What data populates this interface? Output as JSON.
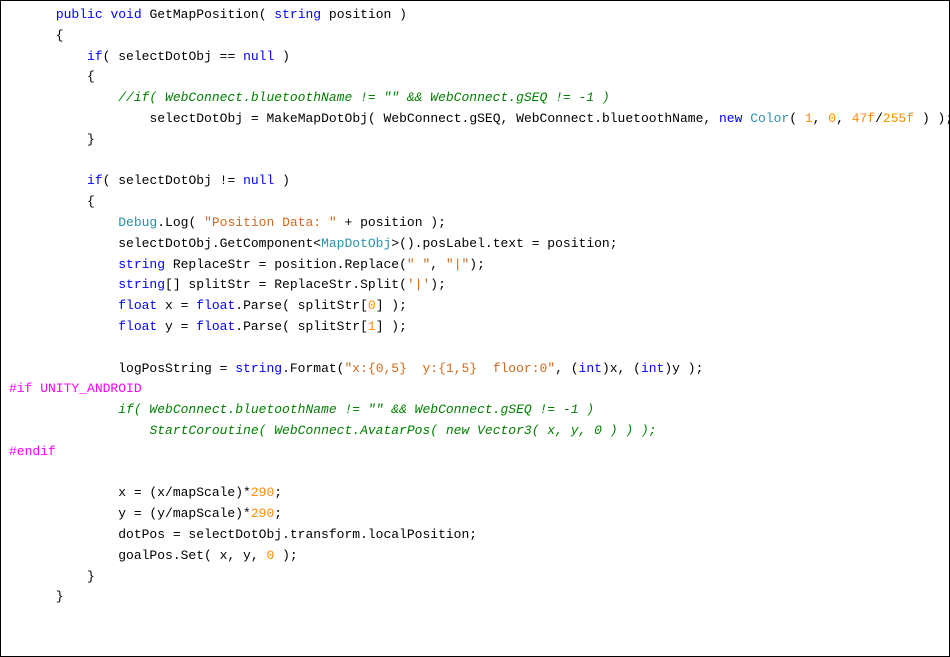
{
  "code": {
    "line1_indent": "      ",
    "kw_public": "public",
    "kw_void": "void",
    "method_name": "GetMapPosition",
    "param_type": "string",
    "param_name": "position",
    "line2_brace_open": "      {",
    "line3_indent": "          ",
    "kw_if": "if",
    "cond1_left": "selectDotObj",
    "op_eq": "==",
    "kw_null": "null",
    "line4_brace": "          {",
    "line5_indent": "              ",
    "comment1": "//if( WebConnect.bluetoothName != \"\" && WebConnect.gSEQ != -1 )",
    "line6_indent": "                  ",
    "assign1_lhs": "selectDotObj",
    "assign1_eq": "=",
    "make_call": "MakeMapDotObj( WebConnect.gSEQ, WebConnect.bluetoothName,",
    "kw_new": "new",
    "color_type": "Color",
    "color_open": "(",
    "num_1": "1",
    "num_0": "0",
    "num_47f": "47f",
    "num_255f": "255f",
    "color_close_tail": " ) );",
    "line7_brace": "          }",
    "line_blank": "",
    "cond2": "selectDotObj !=",
    "line9_brace": "          {",
    "debug_type": "Debug",
    "debug_log": ".Log(",
    "string_posdata": "\"Position Data: \"",
    "plus_position": " + position );",
    "line11": "              selectDotObj.GetComponent<",
    "mapdot_type": "MapDotObj",
    "line11_tail": ">().posLabel.text = position;",
    "line12_kw_string": "string",
    "line12_var": " ReplaceStr = position.Replace(",
    "string_space": "\" \"",
    "comma_sep": ", ",
    "string_pipe": "\"|\"",
    "line12_tail": ");",
    "line13_b": "[] splitStr = ReplaceStr.Split(",
    "char_pipe": "'|'",
    "line13_tail": ");",
    "kw_float": "float",
    "line14_mid": " x = ",
    "float_type": "float",
    "parse_call": ".Parse( splitStr[",
    "idx0": "0",
    "line14_tail": "] );",
    "line15_mid": " y = ",
    "idx1": "1",
    "line15_tail": "] );",
    "line16_lhs": "              logPosString = ",
    "string_type": "string",
    "format_call": ".Format(",
    "format_str": "\"x:{0,5}  y:{1,5}  floor:0\"",
    "format_tail_a": ", (",
    "kw_int": "int",
    "format_tail_b": ")x, (",
    "format_tail_c": ")y );",
    "preproc_if": "#if UNITY_ANDROID",
    "comment2": "if( WebConnect.bluetoothName != \"\" && WebConnect.gSEQ != -1 )",
    "comment3": "StartCoroutine( WebConnect.AvatarPos( new Vector3( x, y, 0 ) ) );",
    "preproc_endif": "#endif",
    "line17": "              x = (x/mapScale)*",
    "num_290": "290",
    "line17_tail": ";",
    "line18": "              y = (y/mapScale)*",
    "line19": "              dotPos = selectDotObj.transform.localPosition;",
    "line20_a": "              goalPos.Set( x, y, ",
    "line20_tail": " );",
    "close_inner": "          }",
    "close_outer": "      }"
  }
}
